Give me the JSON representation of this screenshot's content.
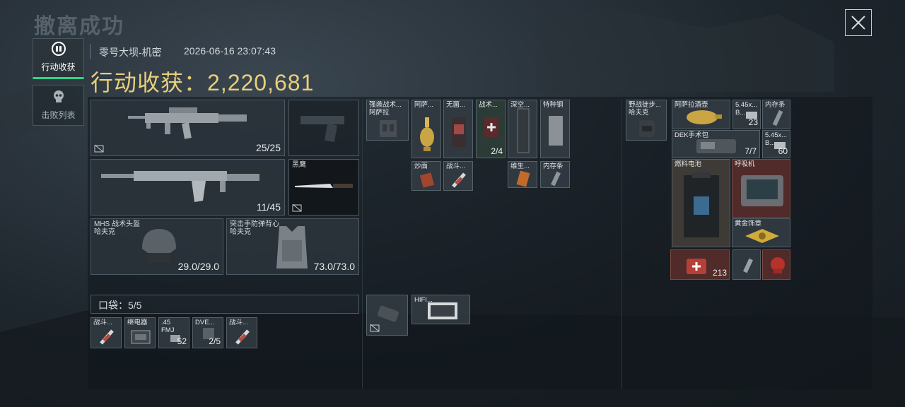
{
  "header": {
    "title": "撤离成功",
    "map_name": "零号大坝-机密",
    "datetime": "2026-06-16 23:07:43",
    "loot_label": "行动收获：",
    "loot_value": "2,220,681"
  },
  "tabs": [
    {
      "label": "行动收获",
      "active": true
    },
    {
      "label": "击败列表",
      "active": false
    }
  ],
  "equipment": {
    "primary_ammo": "25/25",
    "secondary_ammo": "11/45",
    "melee_name": "黑鹰",
    "helmet_name": "MHS 战术头盔",
    "helmet_maker": "哈夫克",
    "helmet_durability": "29.0/29.0",
    "armor_name": "突击手防弹背心",
    "armor_maker": "哈夫克",
    "armor_durability": "73.0/73.0"
  },
  "pocket": {
    "label": "口袋：5/5",
    "items": [
      {
        "name": "战斗...",
        "value": ""
      },
      {
        "name": "继电器",
        "value": ""
      },
      {
        "name": ".45",
        "sub": "FMJ",
        "value": "52"
      },
      {
        "name": "DVE...",
        "value": "2/5"
      },
      {
        "name": "战斗...",
        "value": ""
      }
    ]
  },
  "chest_rig": {
    "name": "强袭战术...",
    "maker": "阿萨拉",
    "items": [
      {
        "name": "阿萨..."
      },
      {
        "name": "无菌..."
      },
      {
        "name": "战术...",
        "value": "2/4"
      },
      {
        "name": "深空..."
      },
      {
        "name": "特种钢"
      },
      {
        "name": "炒面"
      },
      {
        "name": "战斗..."
      },
      {
        "name": "维生..."
      },
      {
        "name": "内存条"
      }
    ],
    "extra_item": {
      "name": "HIFI..."
    }
  },
  "backpack": {
    "name": "野战徒步...",
    "maker": "哈夫克",
    "items": [
      {
        "name": "阿萨拉酒壶"
      },
      {
        "name": "5.45x...",
        "sub": "B...",
        "value": "23"
      },
      {
        "name": "内存条"
      },
      {
        "name": "DEK手术包",
        "value": "7/7"
      },
      {
        "name": "5.45x...",
        "sub": "B...",
        "value": "60"
      },
      {
        "name": "燃料电池"
      },
      {
        "name": "呼吸机"
      },
      {
        "name": "黄金饰章"
      },
      {
        "name": "",
        "value": "213"
      }
    ]
  },
  "colors": {
    "accent": "#2fd38a",
    "gold": "#e8cf7a",
    "red_tile": "#5c2e2a"
  }
}
